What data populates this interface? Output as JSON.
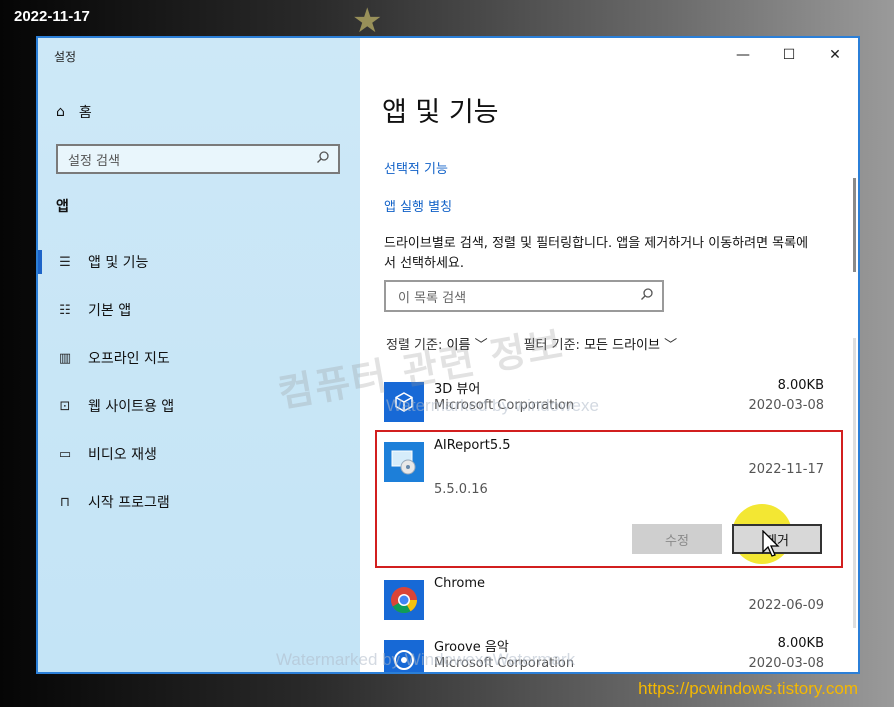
{
  "overlay": {
    "date": "2022-11-17",
    "url": "https://pcwindows.tistory.com",
    "watermark_main": "컴퓨터 관련 정보",
    "watermark_1": "Watermarked by windowexe",
    "watermark_2": "Watermarked by WindowexeWatermark"
  },
  "window": {
    "title": "설정",
    "controls": {
      "minimize": "—",
      "maximize": "☐",
      "close": "✕"
    }
  },
  "sidebar": {
    "home": "홈",
    "search_placeholder": "설정 검색",
    "section": "앱",
    "items": [
      {
        "label": "앱 및 기능",
        "icon": "apps-features-icon"
      },
      {
        "label": "기본 앱",
        "icon": "default-apps-icon"
      },
      {
        "label": "오프라인 지도",
        "icon": "offline-maps-icon"
      },
      {
        "label": "웹 사이트용 앱",
        "icon": "apps-for-websites-icon"
      },
      {
        "label": "비디오 재생",
        "icon": "video-playback-icon"
      },
      {
        "label": "시작 프로그램",
        "icon": "startup-icon"
      }
    ]
  },
  "main": {
    "title": "앱 및 기능",
    "link_optional": "선택적 기능",
    "link_alias": "앱 실행 별칭",
    "description": "드라이브별로 검색, 정렬 및 필터링합니다. 앱을 제거하거나 이동하려면 목록에서 선택하세요.",
    "list_search_placeholder": "이 목록 검색",
    "sort_label": "정렬 기준:",
    "sort_value": "이름",
    "filter_label": "필터 기준:",
    "filter_value": "모든 드라이브",
    "apps": [
      {
        "name": "3D 뷰어",
        "publisher": "Microsoft Corporation",
        "size": "8.00KB",
        "date": "2020-03-08"
      },
      {
        "name": "AIReport5.5",
        "version": "5.5.0.16",
        "date": "2022-11-17",
        "modify": "수정",
        "remove": "제거"
      },
      {
        "name": "Chrome",
        "date": "2022-06-09"
      },
      {
        "name": "Groove 음악",
        "publisher": "Microsoft Corporation",
        "size": "8.00KB",
        "date": "2020-03-08"
      }
    ]
  },
  "colors": {
    "accent": "#1262c8",
    "sidebar_bg": "#cde8f7",
    "selection_border": "#d21f1f",
    "window_border": "#2b7fd8"
  }
}
